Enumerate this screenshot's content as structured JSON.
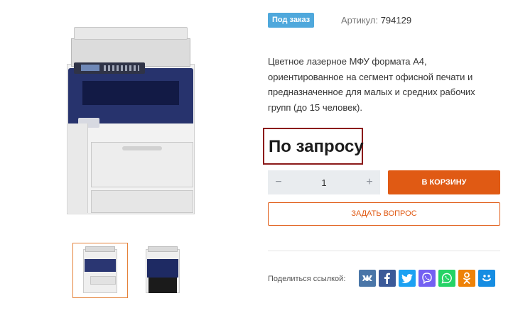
{
  "product": {
    "badge": "Под заказ",
    "sku_label": "Артикул:",
    "sku_value": "794129",
    "description": "Цветное лазерное МФУ формата А4, ориентированное на сегмент офисной печати и предназначенное для малых и средних рабочих групп (до 15 человек).",
    "price": "По запросу"
  },
  "quantity": {
    "minus": "−",
    "value": "1",
    "plus": "+"
  },
  "buttons": {
    "cart": "В КОРЗИНУ",
    "ask": "ЗАДАТЬ ВОПРОС"
  },
  "share": {
    "label": "Поделиться ссылкой:",
    "networks": [
      {
        "icon": "vk-icon",
        "color": "#4a76a8"
      },
      {
        "icon": "facebook-icon",
        "color": "#3b5998"
      },
      {
        "icon": "twitter-icon",
        "color": "#1da1f2"
      },
      {
        "icon": "viber-icon",
        "color": "#7360f2"
      },
      {
        "icon": "whatsapp-icon",
        "color": "#25d366"
      },
      {
        "icon": "odnoklassniki-icon",
        "color": "#ee8208"
      },
      {
        "icon": "moimir-icon",
        "color": "#168de2"
      }
    ]
  },
  "gallery": {
    "thumbnails": [
      "printer-front-thumbnail",
      "printer-open-thumbnail"
    ],
    "active_index": 0
  },
  "colors": {
    "accent": "#e05a14",
    "badge": "#4fa8dc",
    "price_border": "#8b1a1a"
  }
}
